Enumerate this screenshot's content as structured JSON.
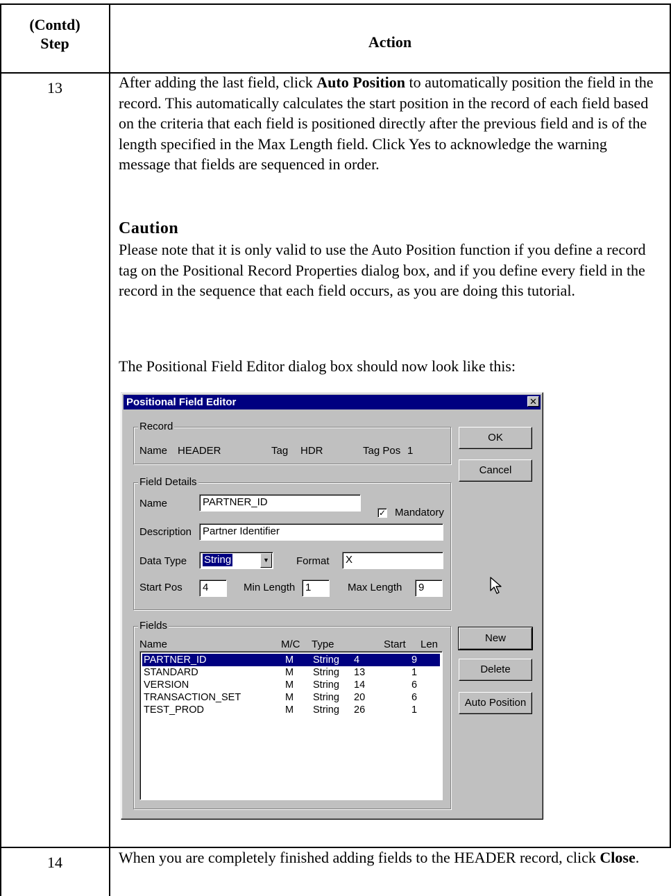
{
  "table": {
    "header_step": "(Contd)\nStep",
    "header_action": "Action"
  },
  "step13": {
    "number": "13",
    "p1_a": "After adding the last field, click ",
    "p1_b": "Auto Position",
    "p1_c": " to automatically position the field in the record. This automatically calculates the start position in the record of each field based on the criteria that each field is positioned directly after the previous field and is of the length specified in the Max Length field. Click Yes to acknowledge the warning message that fields are sequenced in order.",
    "caution_title": "Caution",
    "caution_text": "Please note that it is only valid to use the Auto Position function if you define a record tag on the Positional Record Properties dialog box, and if you define every field in the record in the sequence that each field occurs, as you are doing this tutorial.",
    "dialog_intro": "The Positional Field Editor dialog box should now look like this:"
  },
  "dialog": {
    "title": "Positional Field Editor",
    "close_glyph": "✕",
    "record": {
      "group_label": "Record",
      "name_label": "Name",
      "name_value": "HEADER",
      "tag_label": "Tag",
      "tag_value": "HDR",
      "tagpos_label": "Tag Pos",
      "tagpos_value": "1"
    },
    "details": {
      "group_label": "Field Details",
      "name_label": "Name",
      "name_value": "PARTNER_ID",
      "mandatory_label": "Mandatory",
      "mandatory_checked": true,
      "description_label": "Description",
      "description_value": "Partner Identifier",
      "datatype_label": "Data Type",
      "datatype_value": "String",
      "format_label": "Format",
      "format_value": "X",
      "startpos_label": "Start Pos",
      "startpos_value": "4",
      "minlen_label": "Min Length",
      "minlen_value": "1",
      "maxlen_label": "Max Length",
      "maxlen_value": "9"
    },
    "fields": {
      "group_label": "Fields",
      "columns": [
        "Name",
        "M/C",
        "Type",
        "Start",
        "Len"
      ],
      "rows": [
        {
          "name": "PARTNER_ID",
          "mc": "M",
          "type": "String",
          "start": "4",
          "len": "9"
        },
        {
          "name": "STANDARD",
          "mc": "M",
          "type": "String",
          "start": "13",
          "len": "1"
        },
        {
          "name": "VERSION",
          "mc": "M",
          "type": "String",
          "start": "14",
          "len": "6"
        },
        {
          "name": "TRANSACTION_SET",
          "mc": "M",
          "type": "String",
          "start": "20",
          "len": "6"
        },
        {
          "name": "TEST_PROD",
          "mc": "M",
          "type": "String",
          "start": "26",
          "len": "1"
        }
      ],
      "selected_index": 0
    },
    "buttons": {
      "ok": "OK",
      "cancel": "Cancel",
      "new": "New",
      "delete": "Delete",
      "auto_position": "Auto Position"
    }
  },
  "step14": {
    "number": "14",
    "p_a": "When you are completely finished adding fields to the HEADER record, click ",
    "p_b": "Close",
    "p_c": "."
  }
}
